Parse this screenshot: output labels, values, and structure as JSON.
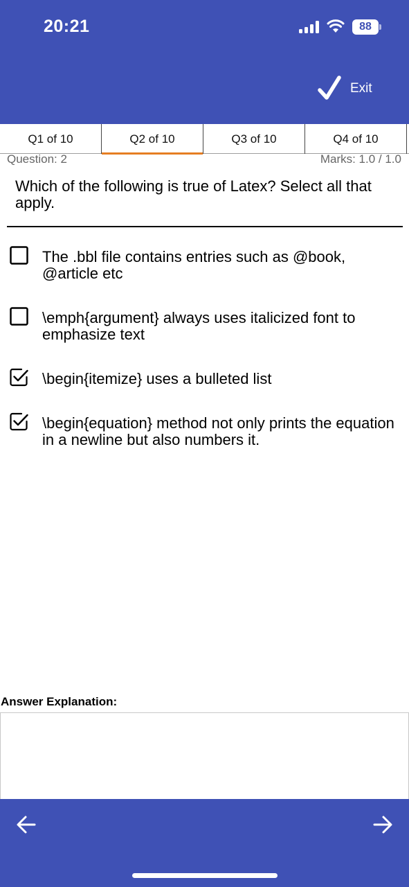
{
  "status": {
    "time": "20:21",
    "battery": "88"
  },
  "header": {
    "exit_label": "Exit"
  },
  "tabs": [
    {
      "label": "Q1 of 10"
    },
    {
      "label": "Q2 of 10"
    },
    {
      "label": "Q3 of 10"
    },
    {
      "label": "Q4 of 10"
    }
  ],
  "active_tab": 1,
  "question": {
    "number_label": "Question: 2",
    "marks_label": "Marks: 1.0 / 1.0",
    "text": "Which of the following is true of Latex? Select all that apply."
  },
  "options": [
    {
      "text": "The .bbl file contains entries such as @book, @article etc",
      "checked": false
    },
    {
      "text": "\\emph{argument} always uses italicized font to emphasize text",
      "checked": false
    },
    {
      "text": "\\begin{itemize} uses a bulleted list",
      "checked": true
    },
    {
      "text": "\\begin{equation} method not only prints the equation in a newline but also numbers it.",
      "checked": true
    }
  ],
  "explanation": {
    "label": "Answer Explanation:",
    "value": ""
  },
  "footer": {
    "prev_icon": "arrow-left-icon",
    "next_icon": "arrow-right-icon"
  },
  "colors": {
    "primary": "#3f51b5",
    "tab_indicator": "#e67e22"
  }
}
